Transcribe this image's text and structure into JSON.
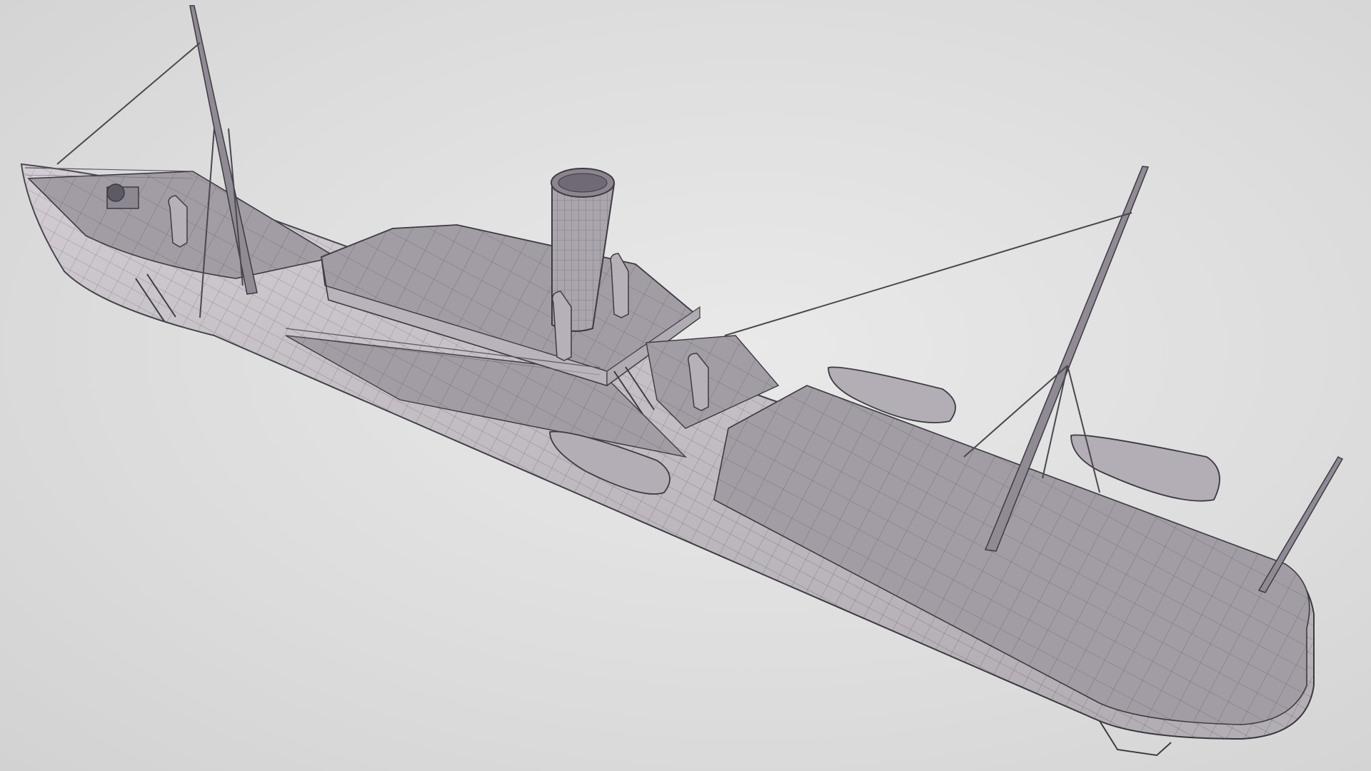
{
  "scene": {
    "subject": "ship-wireframe",
    "background_color": "#dcdcdc",
    "hull_color": "#c9c3ca",
    "deck_color": "#9e99a1",
    "wire_color": "#5a5660",
    "elements": [
      "hull",
      "deck",
      "superstructure",
      "funnel",
      "masts",
      "rigging",
      "lifeboats",
      "ventilators",
      "railings",
      "ladders"
    ]
  }
}
